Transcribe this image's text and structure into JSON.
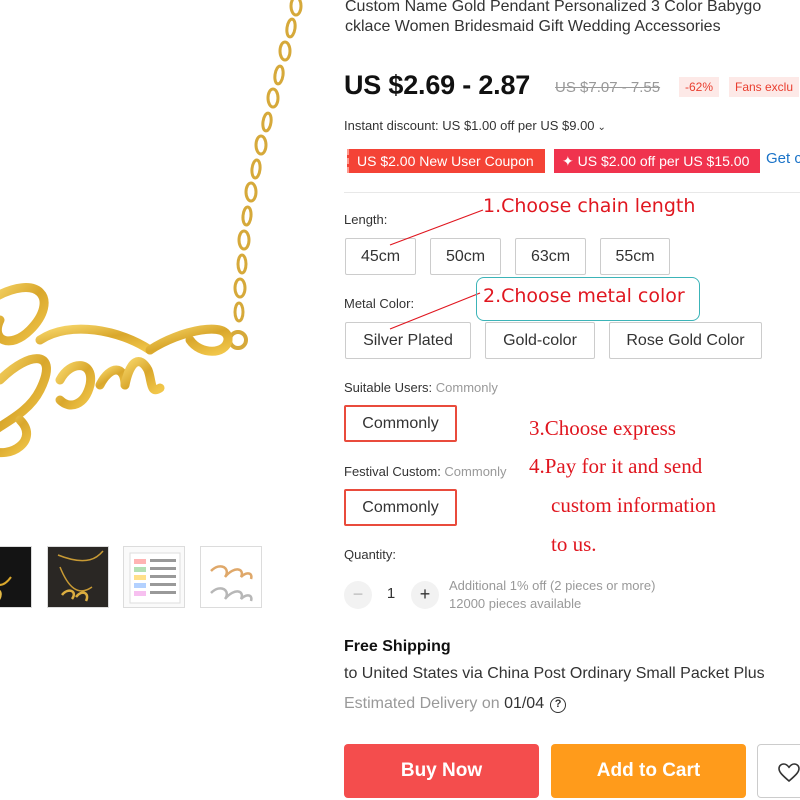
{
  "product": {
    "title_line1": "Custom Name Gold Pendant Personalized 3 Color Babygo",
    "title_line2": "cklace Women Bridesmaid Gift Wedding Accessories",
    "pendant_text": "Babygirl"
  },
  "pricing": {
    "price": "US $2.69 - 2.87",
    "original_price": "US $7.07 - 7.55",
    "discount": "-62%",
    "fans_badge": "Fans exclu",
    "instant_discount": "Instant discount: US $1.00 off per US $9.00"
  },
  "coupons": {
    "new_user": "US $2.00 New User Coupon",
    "store": "✦ US $2.00 off per US $15.00",
    "get_link": "Get c"
  },
  "options": {
    "length": {
      "label": "Length:",
      "values": [
        "45cm",
        "50cm",
        "63cm",
        "55cm"
      ]
    },
    "metal_color": {
      "label": "Metal Color:",
      "values": [
        "Silver Plated",
        "Gold-color",
        "Rose Gold Color"
      ]
    },
    "suitable_users": {
      "label": "Suitable Users: ",
      "selected_text": "Commonly",
      "value": "Commonly"
    },
    "festival_custom": {
      "label": "Festival Custom: ",
      "selected_text": "Commonly",
      "value": "Commonly"
    }
  },
  "annotations": {
    "step1": "1.Choose chain length",
    "step2": "2.Choose metal color",
    "step3": "3.Choose express",
    "step4_line1": "4.Pay for it and send",
    "step4_line2": "custom information",
    "step4_line3": "to us."
  },
  "quantity": {
    "label": "Quantity:",
    "value": "1",
    "minus": "−",
    "plus": "+",
    "note1": "Additional 1% off (2 pieces or more)",
    "note2": "12000 pieces available"
  },
  "shipping": {
    "title": "Free Shipping",
    "line": "to United States via China Post Ordinary Small Packet Plus",
    "delivery_prefix": "Estimated Delivery on ",
    "delivery_date": "01/04",
    "help_glyph": "?"
  },
  "actions": {
    "buy_now": "Buy Now",
    "add_to_cart": "Add to Cart"
  },
  "icons": {
    "instant_chevron": "chevron-down-icon",
    "help": "question-circle-icon",
    "wishlist": "heart-icon"
  },
  "colors": {
    "accent_red": "#f44d4d",
    "cart_orange": "#ff9b1b",
    "annotation_red": "#e0161f",
    "chain_gold": "#e2b63a"
  }
}
